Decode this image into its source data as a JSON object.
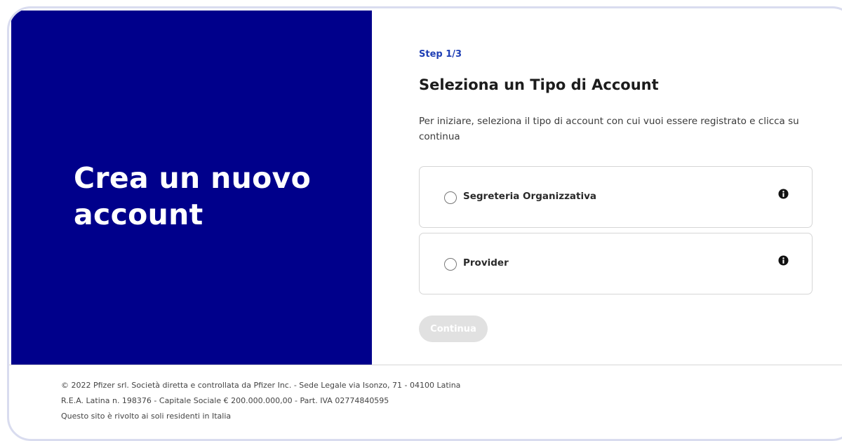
{
  "hero": {
    "title": "Crea un nuovo account"
  },
  "form": {
    "step": "Step 1/3",
    "heading": "Seleziona un Tipo di Account",
    "description": "Per iniziare, seleziona il tipo di account con cui vuoi essere registrato e clicca su continua",
    "options": [
      {
        "label": "Segreteria Organizzativa",
        "selected": false,
        "icon": "info-icon"
      },
      {
        "label": "Provider",
        "selected": false,
        "icon": "info-icon"
      }
    ],
    "continue_label": "Continua",
    "continue_enabled": false
  },
  "footer": {
    "lines": [
      "© 2022 Pfizer srl. Società diretta e controllata da Pfizer Inc. - Sede Legale via Isonzo, 71 - 04100 Latina",
      "R.E.A. Latina n. 198376 - Capitale Sociale € 200.000.000,00 - Part. IVA 02774840595",
      "Questo sito è rivolto ai soli residenti in Italia"
    ]
  },
  "colors": {
    "hero_background": "#00008b",
    "step_text": "#1f3fb5",
    "button_disabled": "#e1e1e1"
  }
}
